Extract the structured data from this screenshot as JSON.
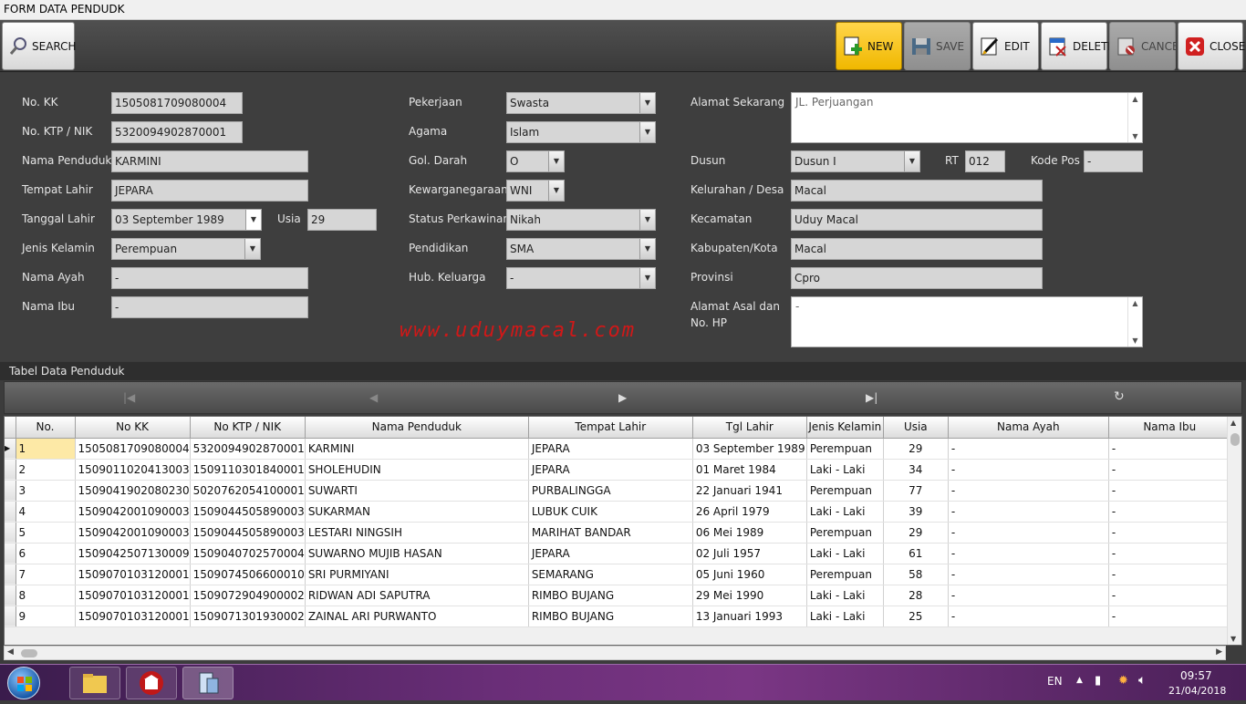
{
  "window": {
    "title": "FORM DATA PENDUDK"
  },
  "toolbar": {
    "search": "SEARCH",
    "new": "NEW",
    "save": "SAVE",
    "edit": "EDIT",
    "delete": "DELETE",
    "cancel": "CANCEL",
    "close": "CLOSE"
  },
  "form": {
    "no_kk": {
      "label": "No. KK",
      "value": "1505081709080004"
    },
    "nik": {
      "label": "No. KTP / NIK",
      "value": "5320094902870001"
    },
    "nama": {
      "label": "Nama Penduduk",
      "value": "KARMINI"
    },
    "tempat_lahir": {
      "label": "Tempat Lahir",
      "value": "JEPARA"
    },
    "tanggal_lahir": {
      "label": "Tanggal Lahir",
      "value": "03 September 1989"
    },
    "usia": {
      "label": "Usia",
      "value": "29"
    },
    "jenis_kelamin": {
      "label": "Jenis Kelamin",
      "value": "Perempuan"
    },
    "nama_ayah": {
      "label": "Nama Ayah",
      "value": "-"
    },
    "nama_ibu": {
      "label": "Nama Ibu",
      "value": "-"
    },
    "pekerjaan": {
      "label": "Pekerjaan",
      "value": "Swasta"
    },
    "agama": {
      "label": "Agama",
      "value": "Islam"
    },
    "gol_darah": {
      "label": "Gol. Darah",
      "value": "O"
    },
    "kewarganegaraan": {
      "label": "Kewarganegaraan",
      "value": "WNI"
    },
    "status_perkawinan": {
      "label": "Status Perkawinan",
      "value": "Nikah"
    },
    "pendidikan": {
      "label": "Pendidikan",
      "value": "SMA"
    },
    "hub_keluarga": {
      "label": "Hub. Keluarga",
      "value": "-"
    },
    "alamat_sekarang": {
      "label": "Alamat Sekarang",
      "value": "JL. Perjuangan"
    },
    "dusun": {
      "label": "Dusun",
      "value": "Dusun I"
    },
    "rt": {
      "label": "RT",
      "value": "012"
    },
    "kode_pos": {
      "label": "Kode Pos",
      "value": "-"
    },
    "kelurahan": {
      "label": "Kelurahan / Desa",
      "value": "Macal"
    },
    "kecamatan": {
      "label": "Kecamatan",
      "value": "Uduy Macal"
    },
    "kabupaten": {
      "label": "Kabupaten/Kota",
      "value": "Macal"
    },
    "provinsi": {
      "label": "Provinsi",
      "value": "Cpro"
    },
    "alamat_asal": {
      "label_line1": "Alamat Asal dan",
      "label_line2": "No. HP",
      "value": "-"
    }
  },
  "watermark": "www.uduymacal.com",
  "table": {
    "title": "Tabel Data Penduduk",
    "columns": [
      "No.",
      "No KK",
      "No KTP / NIK",
      "Nama Penduduk",
      "Tempat Lahir",
      "Tgl Lahir",
      "Jenis Kelamin",
      "Usia",
      "Nama Ayah",
      "Nama Ibu"
    ],
    "rows": [
      [
        "1",
        "1505081709080004",
        "5320094902870001",
        "KARMINI",
        "JEPARA",
        "03 September 1989",
        "Perempuan",
        "29",
        "-",
        "-"
      ],
      [
        "2",
        "1509011020413003",
        "1509110301840001",
        "SHOLEHUDIN",
        "JEPARA",
        "01 Maret 1984",
        "Laki - Laki",
        "34",
        "-",
        "-"
      ],
      [
        "3",
        "1509041902080230",
        "5020762054100001",
        "SUWARTI",
        "PURBALINGGA",
        "22 Januari 1941",
        "Perempuan",
        "77",
        "-",
        "-"
      ],
      [
        "4",
        "1509042001090003",
        "1509044505890003",
        "SUKARMAN",
        "LUBUK CUIK",
        "26 April 1979",
        "Laki - Laki",
        "39",
        "-",
        "-"
      ],
      [
        "5",
        "1509042001090003",
        "1509044505890003",
        "LESTARI NINGSIH",
        "MARIHAT BANDAR",
        "06 Mei 1989",
        "Perempuan",
        "29",
        "-",
        "-"
      ],
      [
        "6",
        "1509042507130009",
        "1509040702570004",
        "SUWARNO MUJIB HASAN",
        "JEPARA",
        "02 Juli 1957",
        "Laki - Laki",
        "61",
        "-",
        "-"
      ],
      [
        "7",
        "1509070103120001",
        "1509074506600010",
        "SRI PURMIYANI",
        "SEMARANG",
        "05 Juni 1960",
        "Perempuan",
        "58",
        "-",
        "-"
      ],
      [
        "8",
        "1509070103120001",
        "1509072904900002",
        "RIDWAN ADI SAPUTRA",
        "RIMBO BUJANG",
        "29 Mei 1990",
        "Laki - Laki",
        "28",
        "-",
        "-"
      ],
      [
        "9",
        "1509070103120001",
        "1509071301930002",
        "ZAINAL ARI PURWANTO",
        "RIMBO BUJANG",
        "13 Januari 1993",
        "Laki - Laki",
        "25",
        "-",
        "-"
      ]
    ]
  },
  "taskbar": {
    "lang": "EN",
    "time": "09:57",
    "date": "21/04/2018"
  }
}
